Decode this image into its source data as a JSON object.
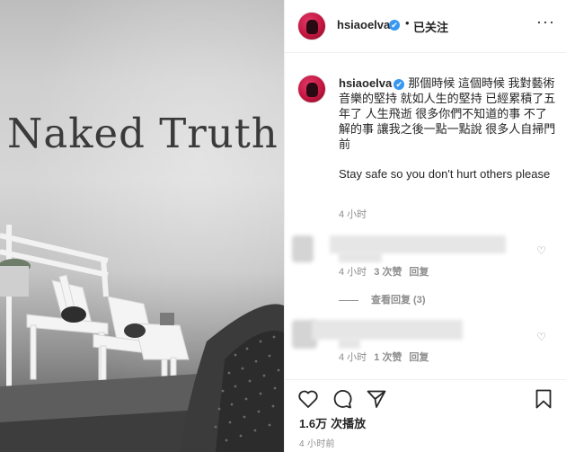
{
  "media": {
    "overlay_text": "Naked Truth"
  },
  "header": {
    "username": "hsiaoelva",
    "verified_mark": "✔",
    "separator": "•",
    "follow_label": "已关注",
    "more_label": "···"
  },
  "caption": {
    "username": "hsiaoelva",
    "verified_mark": "✔",
    "text": "那個時候 這個時候 我對藝術音樂的堅持 就如人生的堅持 已經累積了五年了 人生飛逝 很多你們不知道的事 不了解的事 讓我之後一點一點說 很多人自掃門前",
    "english": "Stay safe so you don't hurt others please",
    "time": "4 小时"
  },
  "comments": [
    {
      "time": "4 小时",
      "likes": "3 次赞",
      "reply": "回复",
      "view_replies": "查看回复 (3)"
    },
    {
      "time": "4 小时",
      "likes": "1 次赞",
      "reply": "回复"
    }
  ],
  "actions": {
    "views_count": "1.6万",
    "views_label": "次播放",
    "post_time": "4 小时前"
  }
}
